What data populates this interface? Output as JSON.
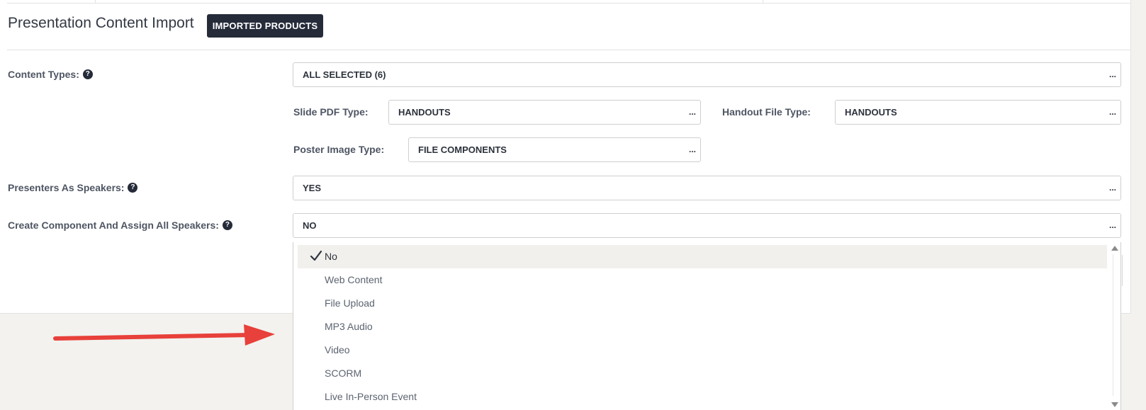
{
  "section": {
    "title": "Presentation Content Import",
    "imported_button": "IMPORTED PRODUCTS"
  },
  "fields": {
    "content_types": {
      "label": "Content Types:",
      "value": "ALL SELECTED (6)"
    },
    "slide_pdf_type": {
      "label": "Slide PDF Type:",
      "value": "HANDOUTS"
    },
    "handout_file_type": {
      "label": "Handout File Type:",
      "value": "HANDOUTS"
    },
    "poster_image_type": {
      "label": "Poster Image Type:",
      "value": "FILE COMPONENTS"
    },
    "presenters_as_speakers": {
      "label": "Presenters As Speakers:",
      "value": "YES"
    },
    "create_component": {
      "label": "Create Component And Assign All Speakers:",
      "value": "NO"
    }
  },
  "select_more": "...",
  "help_glyph": "?",
  "dropdown": {
    "selected": "No",
    "options": [
      "No",
      "Web Content",
      "File Upload",
      "MP3 Audio",
      "Video",
      "SCORM",
      "Live In-Person Event"
    ]
  },
  "colors": {
    "dark_button": "#262b3a",
    "annotation_arrow": "#e8403a",
    "selected_row": "#f1f0ec"
  },
  "icons": {
    "help": "help-icon",
    "check": "check-icon",
    "scroll_up": "scroll-up-arrow-icon",
    "scroll_down": "scroll-down-arrow-icon",
    "annotation": "red-arrow-icon"
  }
}
